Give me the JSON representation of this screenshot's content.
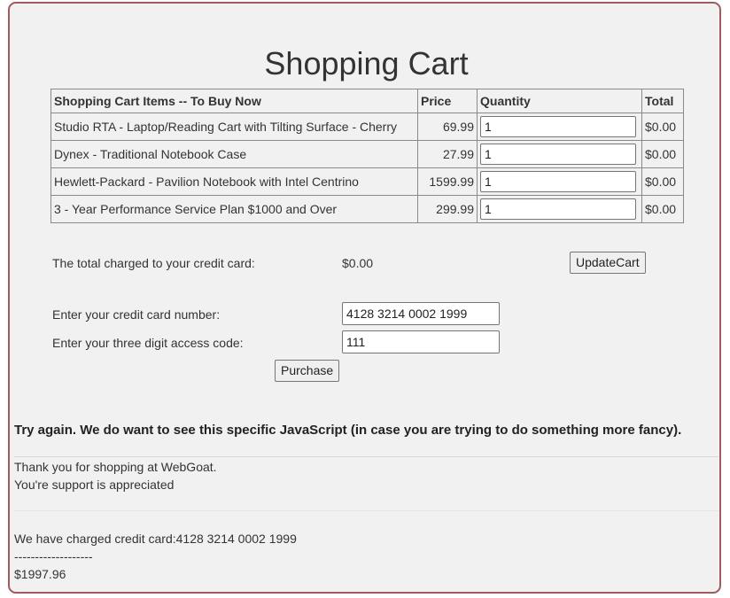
{
  "page": {
    "title": "Shopping Cart"
  },
  "table": {
    "headers": {
      "item": "Shopping Cart Items -- To Buy Now",
      "price": "Price",
      "quantity": "Quantity",
      "total": "Total"
    },
    "rows": [
      {
        "item": "Studio RTA - Laptop/Reading Cart with Tilting Surface - Cherry",
        "price": "69.99",
        "quantity": "1",
        "total": "$0.00"
      },
      {
        "item": "Dynex - Traditional Notebook Case",
        "price": "27.99",
        "quantity": "1",
        "total": "$0.00"
      },
      {
        "item": "Hewlett-Packard - Pavilion Notebook with Intel Centrino",
        "price": "1599.99",
        "quantity": "1",
        "total": "$0.00"
      },
      {
        "item": "3 - Year Performance Service Plan $1000 and Over",
        "price": "299.99",
        "quantity": "1",
        "total": "$0.00"
      }
    ]
  },
  "summary": {
    "total_label": "The total charged to your credit card:",
    "total_value": "$0.00",
    "update_button": "UpdateCart"
  },
  "payment": {
    "card_label": "Enter your credit card number:",
    "card_value": "4128 3214 0002 1999",
    "code_label": "Enter your three digit access code:",
    "code_value": "111",
    "purchase_button": "Purchase"
  },
  "messages": {
    "feedback": "Try again. We do want to see this specific JavaScript (in case you are trying to do something more fancy).",
    "thanks": "Thank you for shopping at WebGoat.",
    "support": "You're support is appreciated",
    "charged": "We have charged credit card:4128 3214 0002 1999",
    "separator": "-------------------",
    "amount": "$1997.96"
  }
}
